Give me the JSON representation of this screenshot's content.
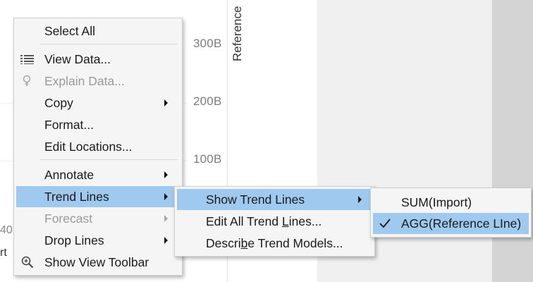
{
  "axis": {
    "title": "Reference",
    "ticks": [
      "300B",
      "200B",
      "100B"
    ]
  },
  "background_clipped_text": {
    "left_number": "40",
    "left_text": "rt"
  },
  "context_menu": {
    "items": [
      {
        "label": "Select All",
        "icon": null,
        "enabled": true,
        "submenu": false
      },
      {
        "label": "View Data...",
        "icon": "table-icon",
        "enabled": true,
        "submenu": false
      },
      {
        "label": "Explain Data...",
        "icon": "lightbulb-icon",
        "enabled": false,
        "submenu": false
      },
      {
        "label": "Copy",
        "icon": null,
        "enabled": true,
        "submenu": true
      },
      {
        "label": "Format...",
        "icon": null,
        "enabled": true,
        "submenu": false
      },
      {
        "label": "Edit Locations...",
        "icon": null,
        "enabled": true,
        "submenu": false
      },
      {
        "label": "Annotate",
        "icon": null,
        "enabled": true,
        "submenu": true
      },
      {
        "label": "Trend Lines",
        "icon": null,
        "enabled": true,
        "submenu": true,
        "highlighted": true
      },
      {
        "label": "Forecast",
        "icon": null,
        "enabled": false,
        "submenu": true
      },
      {
        "label": "Drop Lines",
        "icon": null,
        "enabled": true,
        "submenu": true
      },
      {
        "label": "Show View Toolbar",
        "icon": "zoom-in-icon",
        "enabled": true,
        "submenu": false
      }
    ]
  },
  "trend_lines_submenu": {
    "show_trend_lines": "Show Trend Lines",
    "edit_all_pre": "Edit All Trend ",
    "edit_all_underlined": "L",
    "edit_all_post": "ines...",
    "describe_pre": "Descri",
    "describe_underlined": "b",
    "describe_post": "e Trend Models..."
  },
  "show_trend_lines_submenu": {
    "items": [
      {
        "label": "SUM(Import)",
        "checked": false
      },
      {
        "label": "AGG(Reference LIne)",
        "checked": true
      }
    ]
  },
  "colors": {
    "highlight": "#9fc9ef",
    "menu_bg": "#f5f5f5",
    "checkmark": "#1a1a1a"
  }
}
